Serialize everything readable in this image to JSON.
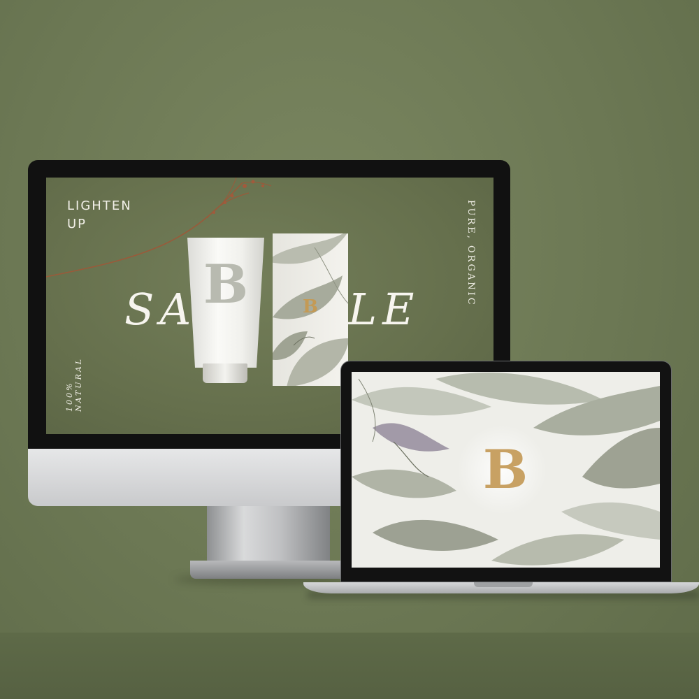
{
  "scene": {
    "background_color": "#6c7854"
  },
  "desktop_screen": {
    "tagline_lines": [
      "LIGHTEN",
      "UP"
    ],
    "side_text_right": "PURE, ORGANIC",
    "side_text_left": "100% NATURAL",
    "brand_left": "SA",
    "brand_right": "LE",
    "tube_letter": "B",
    "box_letter": "B"
  },
  "laptop_screen": {
    "logo_letter": "B",
    "logo_color": "#c8a163"
  }
}
